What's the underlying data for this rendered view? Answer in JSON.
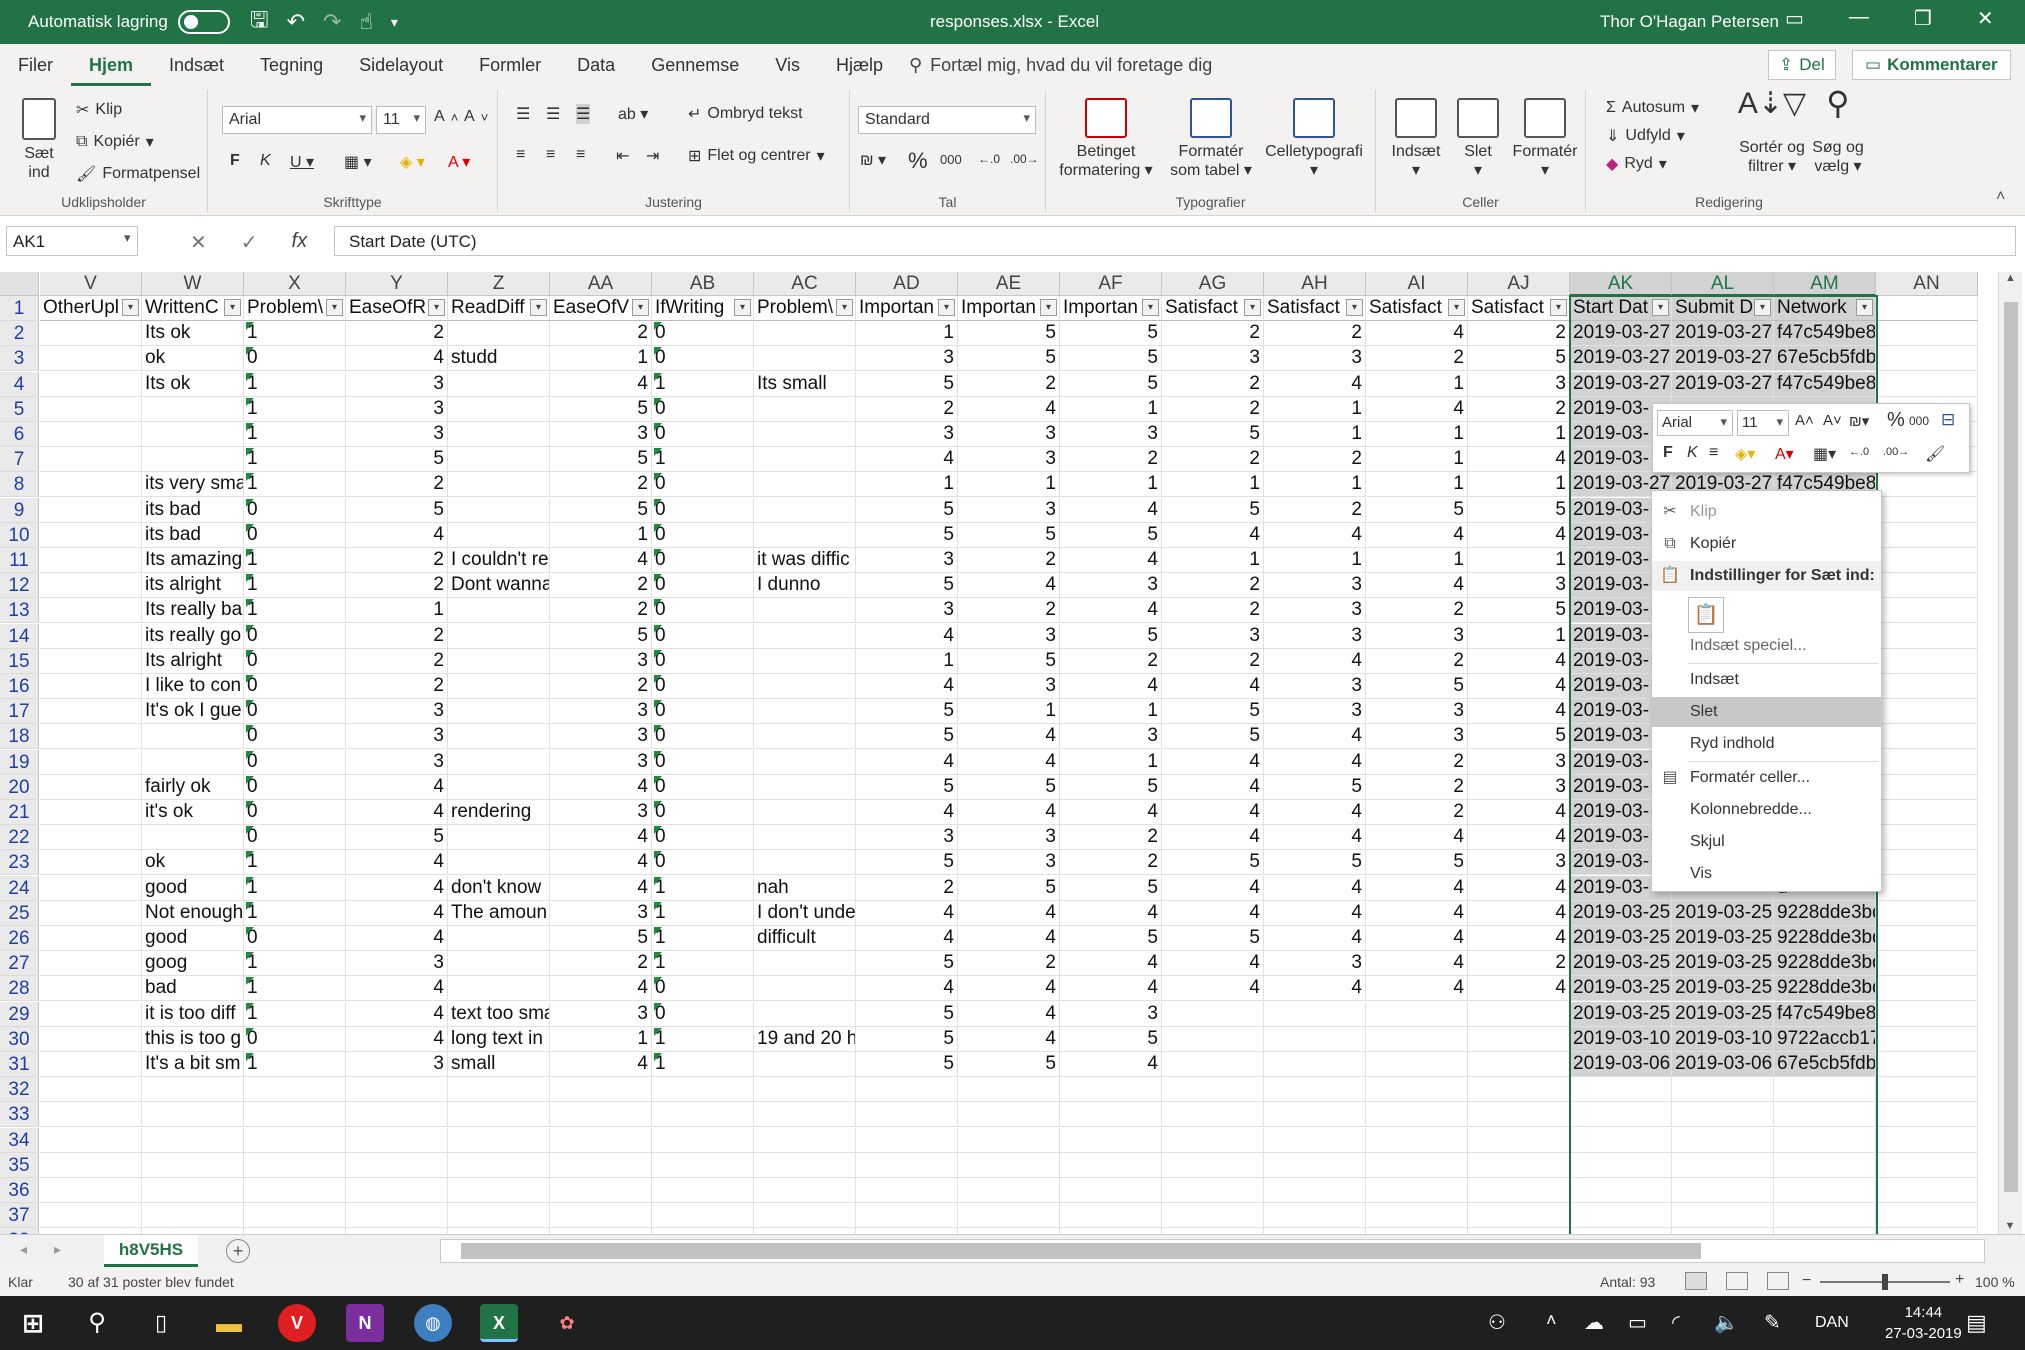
{
  "titlebar": {
    "autosave_label": "Automatisk lagring",
    "doc_title": "responses.xlsx - Excel",
    "user_name": "Thor O'Hagan Petersen"
  },
  "tabs": [
    "Filer",
    "Hjem",
    "Indsæt",
    "Tegning",
    "Sidelayout",
    "Formler",
    "Data",
    "Gennemse",
    "Vis",
    "Hjælp"
  ],
  "active_tab": "Hjem",
  "tell_me": "Fortæl mig, hvad du vil foretage dig",
  "share_label": "Del",
  "comment_label": "Kommentarer",
  "ribbon": {
    "paste": "Sæt ind",
    "cut": "Klip",
    "copy": "Kopiér",
    "format_painter": "Formatpensel",
    "clipboard": "Udklipsholder",
    "font_name": "Arial",
    "font_size": "11",
    "font_group": "Skrifttype",
    "wrap_text": "Ombryd tekst",
    "merge_center": "Flet og centrer",
    "alignment": "Justering",
    "number_format": "Standard",
    "number_group": "Tal",
    "conditional": "Betinget formatering",
    "format_table": "Formatér som tabel",
    "cell_styles": "Celletypografi",
    "styles_group": "Typografier",
    "insert": "Indsæt",
    "delete": "Slet",
    "format": "Formatér",
    "cells_group": "Celler",
    "autosum": "Autosum",
    "fill": "Udfyld",
    "clear": "Ryd",
    "sort_filter": "Sortér og filtrer",
    "find_select": "Søg og vælg",
    "editing_group": "Redigering"
  },
  "formula_bar": {
    "name_box": "AK1",
    "formula": "Start Date (UTC)"
  },
  "columns": [
    "V",
    "W",
    "X",
    "Y",
    "Z",
    "AA",
    "AB",
    "AC",
    "AD",
    "AE",
    "AF",
    "AG",
    "AH",
    "AI",
    "AJ",
    "AK",
    "AL",
    "AM",
    "AN"
  ],
  "headers": [
    "OtherUpl",
    "WrittenC",
    "Problem\\",
    "EaseOfR",
    "ReadDiff",
    "EaseOfV",
    "IfWriting",
    "Problem\\",
    "Importan",
    "Importan",
    "Importan",
    "Satisfact",
    "Satisfact",
    "Satisfact",
    "Satisfact",
    "Start Dat",
    "Submit D",
    "Network",
    ""
  ],
  "row_numbers": [
    "1",
    "2",
    "3",
    "4",
    "5",
    "6",
    "7",
    "8",
    "9",
    "10",
    "11",
    "12",
    "13",
    "14",
    "15",
    "16",
    "17",
    "18",
    "19",
    "20",
    "21",
    "22",
    "23",
    "24",
    "25",
    "26",
    "27",
    "28",
    "29",
    "30",
    "31",
    "32",
    "33",
    "34",
    "35",
    "36",
    "37",
    "38"
  ],
  "rows": [
    [
      "",
      "Its ok",
      "1",
      "2",
      "",
      "2",
      "0",
      "",
      "1",
      "5",
      "5",
      "2",
      "2",
      "4",
      "2",
      "2019-03-27",
      "2019-03-27",
      "f47c549be8",
      ""
    ],
    [
      "",
      "ok",
      "0",
      "4",
      "studd",
      "1",
      "0",
      "",
      "3",
      "5",
      "5",
      "3",
      "3",
      "2",
      "5",
      "2019-03-27",
      "2019-03-27",
      "67e5cb5fdb",
      ""
    ],
    [
      "",
      "Its ok",
      "1",
      "3",
      "",
      "4",
      "1",
      "Its small",
      "5",
      "2",
      "5",
      "2",
      "4",
      "1",
      "3",
      "2019-03-27",
      "2019-03-27",
      "f47c549be8",
      ""
    ],
    [
      "",
      "",
      "1",
      "3",
      "",
      "5",
      "0",
      "",
      "2",
      "4",
      "1",
      "2",
      "1",
      "4",
      "2",
      "2019-03-",
      "",
      "",
      ""
    ],
    [
      "",
      "",
      "1",
      "3",
      "",
      "3",
      "0",
      "",
      "3",
      "3",
      "3",
      "5",
      "1",
      "1",
      "1",
      "2019-03-",
      "",
      "",
      ""
    ],
    [
      "",
      "",
      "1",
      "5",
      "",
      "5",
      "1",
      "",
      "4",
      "3",
      "2",
      "2",
      "2",
      "1",
      "4",
      "2019-03-",
      "",
      "",
      ""
    ],
    [
      "",
      "its very sma",
      "1",
      "2",
      "",
      "2",
      "0",
      "",
      "1",
      "1",
      "1",
      "1",
      "1",
      "1",
      "1",
      "2019-03-27",
      "2019-03-27",
      "f47c549be8",
      ""
    ],
    [
      "",
      "its bad",
      "0",
      "5",
      "",
      "5",
      "0",
      "",
      "5",
      "3",
      "4",
      "5",
      "2",
      "5",
      "5",
      "2019-03-",
      "",
      "",
      ""
    ],
    [
      "",
      "its bad",
      "0",
      "4",
      "",
      "1",
      "0",
      "",
      "5",
      "5",
      "5",
      "4",
      "4",
      "4",
      "4",
      "2019-03-",
      "",
      "",
      ""
    ],
    [
      "",
      "Its amazing",
      "1",
      "2",
      "I couldn't re",
      "4",
      "0",
      "it was diffic",
      "3",
      "2",
      "4",
      "1",
      "1",
      "1",
      "1",
      "2019-03-",
      "",
      "",
      ""
    ],
    [
      "",
      "its alright",
      "1",
      "2",
      "Dont wanna",
      "2",
      "0",
      "I dunno",
      "5",
      "4",
      "3",
      "2",
      "3",
      "4",
      "3",
      "2019-03-",
      "",
      "",
      ""
    ],
    [
      "",
      "Its really ba",
      "1",
      "1",
      "",
      "2",
      "0",
      "",
      "3",
      "2",
      "4",
      "2",
      "3",
      "2",
      "5",
      "2019-03-",
      "",
      "",
      ""
    ],
    [
      "",
      "its really go",
      "0",
      "2",
      "",
      "5",
      "0",
      "",
      "4",
      "3",
      "5",
      "3",
      "3",
      "3",
      "1",
      "2019-03-",
      "",
      "",
      ""
    ],
    [
      "",
      "Its alright",
      "0",
      "2",
      "",
      "3",
      "0",
      "",
      "1",
      "5",
      "2",
      "2",
      "4",
      "2",
      "4",
      "2019-03-",
      "",
      "",
      ""
    ],
    [
      "",
      "I like to con",
      "0",
      "2",
      "",
      "2",
      "0",
      "",
      "4",
      "3",
      "4",
      "4",
      "3",
      "5",
      "4",
      "2019-03-",
      "",
      "e",
      ""
    ],
    [
      "",
      "It's ok I gue",
      "0",
      "3",
      "",
      "3",
      "0",
      "",
      "5",
      "1",
      "1",
      "5",
      "3",
      "3",
      "4",
      "2019-03-",
      "",
      "e",
      ""
    ],
    [
      "",
      "",
      "0",
      "3",
      "",
      "3",
      "0",
      "",
      "5",
      "4",
      "3",
      "5",
      "4",
      "3",
      "5",
      "2019-03-",
      "",
      "e",
      ""
    ],
    [
      "",
      "",
      "0",
      "3",
      "",
      "3",
      "0",
      "",
      "4",
      "4",
      "1",
      "4",
      "4",
      "2",
      "3",
      "2019-03-",
      "",
      "e",
      ""
    ],
    [
      "",
      "fairly ok",
      "0",
      "4",
      "",
      "4",
      "0",
      "",
      "5",
      "5",
      "5",
      "4",
      "5",
      "2",
      "3",
      "2019-03-",
      "",
      "d",
      ""
    ],
    [
      "",
      "it's ok",
      "0",
      "4",
      "rendering",
      "3",
      "0",
      "",
      "4",
      "4",
      "4",
      "4",
      "4",
      "2",
      "4",
      "2019-03-",
      "",
      "d",
      ""
    ],
    [
      "",
      "",
      "0",
      "5",
      "",
      "4",
      "0",
      "",
      "3",
      "3",
      "2",
      "4",
      "4",
      "4",
      "4",
      "2019-03-",
      "",
      "d",
      ""
    ],
    [
      "",
      "ok",
      "1",
      "4",
      "",
      "4",
      "0",
      "",
      "5",
      "3",
      "2",
      "5",
      "5",
      "5",
      "3",
      "2019-03-",
      "",
      "d",
      ""
    ],
    [
      "",
      "good",
      "1",
      "4",
      "don't know",
      "4",
      "1",
      "nah",
      "2",
      "5",
      "5",
      "4",
      "4",
      "4",
      "4",
      "2019-03-",
      "",
      "d",
      ""
    ],
    [
      "",
      "Not enough",
      "1",
      "4",
      "The amoun",
      "3",
      "1",
      "I don't unde",
      "4",
      "4",
      "4",
      "4",
      "4",
      "4",
      "4",
      "2019-03-25",
      "2019-03-25",
      "9228dde3bd",
      ""
    ],
    [
      "",
      "good",
      "0",
      "4",
      "",
      "5",
      "1",
      "difficult",
      "4",
      "4",
      "5",
      "5",
      "4",
      "4",
      "4",
      "2019-03-25",
      "2019-03-25",
      "9228dde3bd",
      ""
    ],
    [
      "",
      "goog",
      "1",
      "3",
      "",
      "2",
      "1",
      "",
      "5",
      "2",
      "4",
      "4",
      "3",
      "4",
      "2",
      "2019-03-25",
      "2019-03-25",
      "9228dde3bd",
      ""
    ],
    [
      "",
      "bad",
      "1",
      "4",
      "",
      "4",
      "0",
      "",
      "4",
      "4",
      "4",
      "4",
      "4",
      "4",
      "4",
      "2019-03-25",
      "2019-03-25",
      "9228dde3bd",
      ""
    ],
    [
      "",
      "it is too diff",
      "1",
      "4",
      "text too sma",
      "3",
      "0",
      "",
      "5",
      "4",
      "3",
      "",
      "",
      "",
      "",
      "2019-03-25",
      "2019-03-25",
      "f47c549be8",
      ""
    ],
    [
      "",
      "this is too g",
      "0",
      "4",
      "long text in",
      "1",
      "1",
      "19 and 20 h",
      "5",
      "4",
      "5",
      "",
      "",
      "",
      "",
      "2019-03-10",
      "2019-03-10",
      "9722accb17",
      ""
    ],
    [
      "",
      "It's a bit sm",
      "1",
      "3",
      "small",
      "4",
      "1",
      "",
      "5",
      "5",
      "4",
      "",
      "",
      "",
      "",
      "2019-03-06",
      "2019-03-06",
      "67e5cb5fdb",
      ""
    ]
  ],
  "mini_toolbar": {
    "font": "Arial",
    "size": "11"
  },
  "context_menu": {
    "cut": "Klip",
    "copy": "Kopiér",
    "paste_options": "Indstillinger for Sæt ind:",
    "paste_special": "Indsæt speciel...",
    "insert": "Indsæt",
    "delete": "Slet",
    "clear": "Ryd indhold",
    "format_cells": "Formatér celler...",
    "col_width": "Kolonnebredde...",
    "hide": "Skjul",
    "show": "Vis"
  },
  "sheet_tab": "h8V5HS",
  "status": {
    "ready": "Klar",
    "found": "30 af 31 poster blev fundet",
    "count": "Antal: 93",
    "zoom": "100 %"
  },
  "taskbar": {
    "lang": "DAN",
    "time": "14:44",
    "date": "27-03-2019"
  },
  "colors": {
    "excel_green": "#217346",
    "selection_gray": "#d2d2d2"
  }
}
